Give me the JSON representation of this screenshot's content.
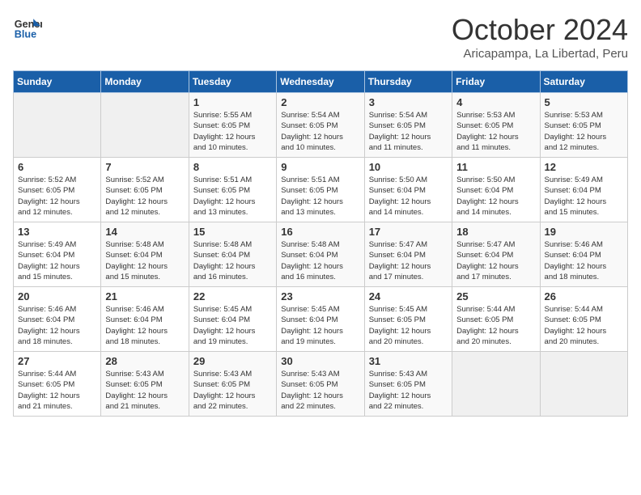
{
  "header": {
    "logo_line1": "General",
    "logo_line2": "Blue",
    "month": "October 2024",
    "location": "Aricapampa, La Libertad, Peru"
  },
  "days_of_week": [
    "Sunday",
    "Monday",
    "Tuesday",
    "Wednesday",
    "Thursday",
    "Friday",
    "Saturday"
  ],
  "weeks": [
    [
      {
        "day": "",
        "info": ""
      },
      {
        "day": "",
        "info": ""
      },
      {
        "day": "1",
        "info": "Sunrise: 5:55 AM\nSunset: 6:05 PM\nDaylight: 12 hours\nand 10 minutes."
      },
      {
        "day": "2",
        "info": "Sunrise: 5:54 AM\nSunset: 6:05 PM\nDaylight: 12 hours\nand 10 minutes."
      },
      {
        "day": "3",
        "info": "Sunrise: 5:54 AM\nSunset: 6:05 PM\nDaylight: 12 hours\nand 11 minutes."
      },
      {
        "day": "4",
        "info": "Sunrise: 5:53 AM\nSunset: 6:05 PM\nDaylight: 12 hours\nand 11 minutes."
      },
      {
        "day": "5",
        "info": "Sunrise: 5:53 AM\nSunset: 6:05 PM\nDaylight: 12 hours\nand 12 minutes."
      }
    ],
    [
      {
        "day": "6",
        "info": "Sunrise: 5:52 AM\nSunset: 6:05 PM\nDaylight: 12 hours\nand 12 minutes."
      },
      {
        "day": "7",
        "info": "Sunrise: 5:52 AM\nSunset: 6:05 PM\nDaylight: 12 hours\nand 12 minutes."
      },
      {
        "day": "8",
        "info": "Sunrise: 5:51 AM\nSunset: 6:05 PM\nDaylight: 12 hours\nand 13 minutes."
      },
      {
        "day": "9",
        "info": "Sunrise: 5:51 AM\nSunset: 6:05 PM\nDaylight: 12 hours\nand 13 minutes."
      },
      {
        "day": "10",
        "info": "Sunrise: 5:50 AM\nSunset: 6:04 PM\nDaylight: 12 hours\nand 14 minutes."
      },
      {
        "day": "11",
        "info": "Sunrise: 5:50 AM\nSunset: 6:04 PM\nDaylight: 12 hours\nand 14 minutes."
      },
      {
        "day": "12",
        "info": "Sunrise: 5:49 AM\nSunset: 6:04 PM\nDaylight: 12 hours\nand 15 minutes."
      }
    ],
    [
      {
        "day": "13",
        "info": "Sunrise: 5:49 AM\nSunset: 6:04 PM\nDaylight: 12 hours\nand 15 minutes."
      },
      {
        "day": "14",
        "info": "Sunrise: 5:48 AM\nSunset: 6:04 PM\nDaylight: 12 hours\nand 15 minutes."
      },
      {
        "day": "15",
        "info": "Sunrise: 5:48 AM\nSunset: 6:04 PM\nDaylight: 12 hours\nand 16 minutes."
      },
      {
        "day": "16",
        "info": "Sunrise: 5:48 AM\nSunset: 6:04 PM\nDaylight: 12 hours\nand 16 minutes."
      },
      {
        "day": "17",
        "info": "Sunrise: 5:47 AM\nSunset: 6:04 PM\nDaylight: 12 hours\nand 17 minutes."
      },
      {
        "day": "18",
        "info": "Sunrise: 5:47 AM\nSunset: 6:04 PM\nDaylight: 12 hours\nand 17 minutes."
      },
      {
        "day": "19",
        "info": "Sunrise: 5:46 AM\nSunset: 6:04 PM\nDaylight: 12 hours\nand 18 minutes."
      }
    ],
    [
      {
        "day": "20",
        "info": "Sunrise: 5:46 AM\nSunset: 6:04 PM\nDaylight: 12 hours\nand 18 minutes."
      },
      {
        "day": "21",
        "info": "Sunrise: 5:46 AM\nSunset: 6:04 PM\nDaylight: 12 hours\nand 18 minutes."
      },
      {
        "day": "22",
        "info": "Sunrise: 5:45 AM\nSunset: 6:04 PM\nDaylight: 12 hours\nand 19 minutes."
      },
      {
        "day": "23",
        "info": "Sunrise: 5:45 AM\nSunset: 6:04 PM\nDaylight: 12 hours\nand 19 minutes."
      },
      {
        "day": "24",
        "info": "Sunrise: 5:45 AM\nSunset: 6:05 PM\nDaylight: 12 hours\nand 20 minutes."
      },
      {
        "day": "25",
        "info": "Sunrise: 5:44 AM\nSunset: 6:05 PM\nDaylight: 12 hours\nand 20 minutes."
      },
      {
        "day": "26",
        "info": "Sunrise: 5:44 AM\nSunset: 6:05 PM\nDaylight: 12 hours\nand 20 minutes."
      }
    ],
    [
      {
        "day": "27",
        "info": "Sunrise: 5:44 AM\nSunset: 6:05 PM\nDaylight: 12 hours\nand 21 minutes."
      },
      {
        "day": "28",
        "info": "Sunrise: 5:43 AM\nSunset: 6:05 PM\nDaylight: 12 hours\nand 21 minutes."
      },
      {
        "day": "29",
        "info": "Sunrise: 5:43 AM\nSunset: 6:05 PM\nDaylight: 12 hours\nand 22 minutes."
      },
      {
        "day": "30",
        "info": "Sunrise: 5:43 AM\nSunset: 6:05 PM\nDaylight: 12 hours\nand 22 minutes."
      },
      {
        "day": "31",
        "info": "Sunrise: 5:43 AM\nSunset: 6:05 PM\nDaylight: 12 hours\nand 22 minutes."
      },
      {
        "day": "",
        "info": ""
      },
      {
        "day": "",
        "info": ""
      }
    ]
  ]
}
